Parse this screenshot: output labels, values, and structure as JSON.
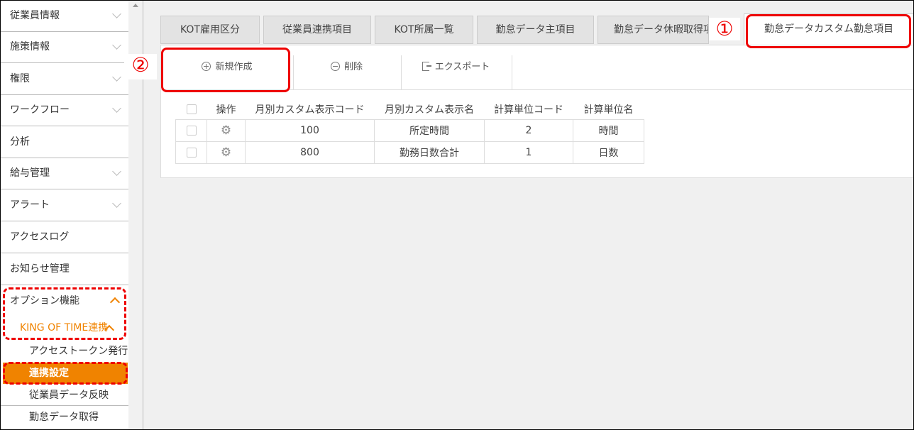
{
  "sidebar": {
    "menu": [
      {
        "label": "従業員情報",
        "chevron": "chevron-down-icon"
      },
      {
        "label": "施策情報",
        "chevron": "chevron-down-icon"
      },
      {
        "label": "権限",
        "chevron": "chevron-down-icon"
      },
      {
        "label": "ワークフロー",
        "chevron": "chevron-down-icon"
      },
      {
        "label": "分析",
        "chevron": ""
      },
      {
        "label": "給与管理",
        "chevron": "chevron-down-icon"
      },
      {
        "label": "アラート",
        "chevron": "chevron-down-icon"
      },
      {
        "label": "アクセスログ",
        "chevron": ""
      },
      {
        "label": "お知らせ管理",
        "chevron": ""
      },
      {
        "label": "オプション機能",
        "chevron": "chevron-up-icon"
      }
    ],
    "kot_label": "KING OF TIME連携",
    "sub_items": [
      "アクセストークン発行",
      "連携設定",
      "従業員データ反映",
      "勤怠データ取得"
    ],
    "active_color": "#f08300"
  },
  "tabs": [
    "KOT雇用区分",
    "従業員連携項目",
    "KOT所属一覧",
    "勤怠データ主項目",
    "勤怠データ休暇取得項目",
    "勤怠データカスタム勤怠項目"
  ],
  "toolbar": {
    "new_label": "新規作成",
    "delete_label": "削除",
    "export_label": "エクスポート"
  },
  "table": {
    "headers": [
      "操作",
      "月別カスタム表示コード",
      "月別カスタム表示名",
      "計算単位コード",
      "計算単位名"
    ],
    "rows": [
      {
        "code": "100",
        "name": "所定時間",
        "unit_code": "2",
        "unit_name": "時間"
      },
      {
        "code": "800",
        "name": "勤務日数合計",
        "unit_code": "1",
        "unit_name": "日数"
      }
    ]
  },
  "annotations": {
    "one": "①",
    "two": "②",
    "color": "#e00000"
  }
}
